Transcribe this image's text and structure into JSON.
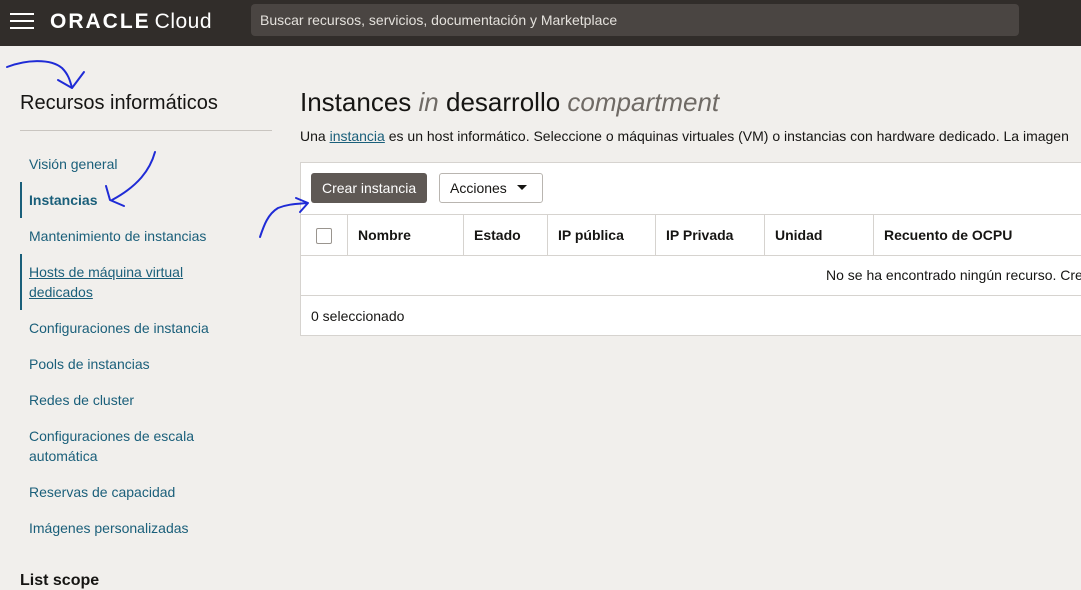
{
  "header": {
    "brand": "ORACLE",
    "product": "Cloud",
    "search_placeholder": "Buscar recursos, servicios, documentación y Marketplace"
  },
  "sidebar": {
    "title": "Recursos informáticos",
    "items": [
      {
        "label": "Visión general"
      },
      {
        "label": "Instancias"
      },
      {
        "label": "Mantenimiento de instancias"
      },
      {
        "label": "Hosts de máquina virtual dedicados"
      },
      {
        "label": "Configuraciones de instancia"
      },
      {
        "label": "Pools de instancias"
      },
      {
        "label": "Redes de cluster"
      },
      {
        "label": "Configuraciones de escala automática"
      },
      {
        "label": "Reservas de capacidad"
      },
      {
        "label": "Imágenes personalizadas"
      }
    ],
    "list_scope": "List scope"
  },
  "main": {
    "title_prefix": "Instances",
    "title_in": "in",
    "compartment": "desarrollo",
    "title_suffix": "compartment",
    "desc_start": "Una ",
    "desc_link": "instancia",
    "desc_rest": " es un host informático. Seleccione o máquinas virtuales (VM) o instancias con hardware dedicado. La imagen",
    "create_button": "Crear instancia",
    "actions_button": "Acciones",
    "columns": [
      "Nombre",
      "Estado",
      "IP pública",
      "IP Privada",
      "Unidad",
      "Recuento de OCPU"
    ],
    "empty_message": "No se ha encontrado ningún recurso. Cre",
    "selected_count": "0 seleccionado"
  },
  "colors": {
    "topbar": "#312d2a",
    "link": "#1a5f7a",
    "annotation": "#1f2bd6"
  }
}
